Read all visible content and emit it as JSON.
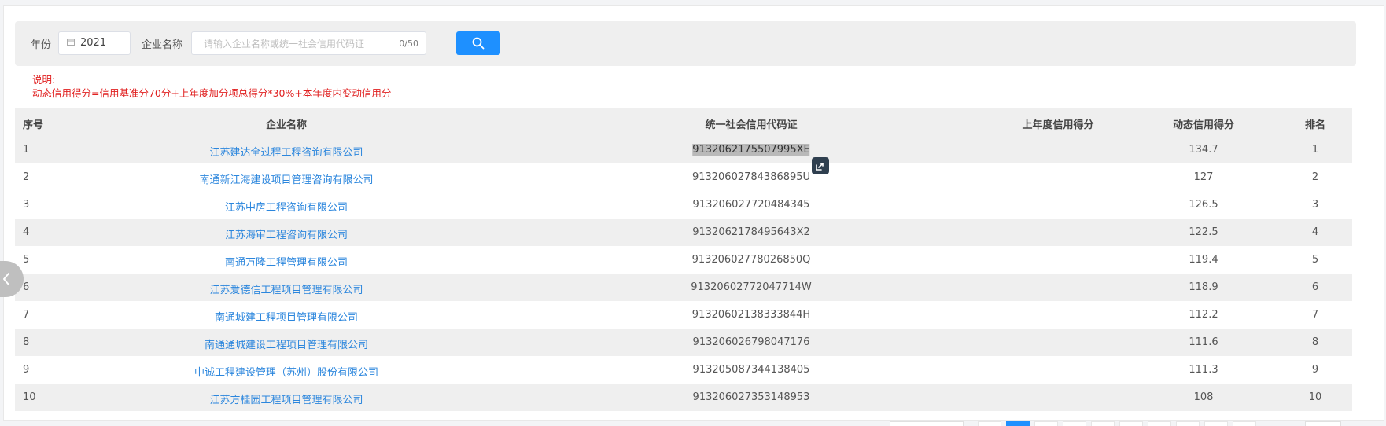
{
  "filter": {
    "year_label": "年份",
    "year_value": "2021",
    "name_label": "企业名称",
    "name_placeholder": "请输入企业名称或统一社会信用代码证",
    "name_count": "0/50"
  },
  "note": {
    "title": "说明:",
    "text": "动态信用得分=信用基准分70分+上年度加分项总得分*30%+本年度内变动信用分"
  },
  "table": {
    "headers": {
      "index": "序号",
      "name": "企业名称",
      "code": "统一社会信用代码证",
      "prev": "上年度信用得分",
      "dynamic": "动态信用得分",
      "rank": "排名"
    },
    "rows": [
      {
        "index": "1",
        "name": "江苏建达全过程工程咨询有限公司",
        "code": "9132062175507995XE",
        "prev": "",
        "dynamic": "134.7",
        "rank": "1"
      },
      {
        "index": "2",
        "name": "南通新江海建设项目管理咨询有限公司",
        "code": "91320602784386895U",
        "prev": "",
        "dynamic": "127",
        "rank": "2"
      },
      {
        "index": "3",
        "name": "江苏中房工程咨询有限公司",
        "code": "913206027720484345",
        "prev": "",
        "dynamic": "126.5",
        "rank": "3"
      },
      {
        "index": "4",
        "name": "江苏海审工程咨询有限公司",
        "code": "9132062178495643X2",
        "prev": "",
        "dynamic": "122.5",
        "rank": "4"
      },
      {
        "index": "5",
        "name": "南通万隆工程管理有限公司",
        "code": "91320602778026850Q",
        "prev": "",
        "dynamic": "119.4",
        "rank": "5"
      },
      {
        "index": "6",
        "name": "江苏爱德信工程项目管理有限公司",
        "code": "91320602772047714W",
        "prev": "",
        "dynamic": "118.9",
        "rank": "6"
      },
      {
        "index": "7",
        "name": "南通城建工程项目管理有限公司",
        "code": "91320602138333844H",
        "prev": "",
        "dynamic": "112.2",
        "rank": "7"
      },
      {
        "index": "8",
        "name": "南通通城建设工程项目管理有限公司",
        "code": "913206026798047176",
        "prev": "",
        "dynamic": "111.6",
        "rank": "8"
      },
      {
        "index": "9",
        "name": "中诚工程建设管理（苏州）股份有限公司",
        "code": "913205087344138405",
        "prev": "",
        "dynamic": "111.3",
        "rank": "9"
      },
      {
        "index": "10",
        "name": "江苏方桂园工程项目管理有限公司",
        "code": "913206027353148953",
        "prev": "",
        "dynamic": "108",
        "rank": "10"
      }
    ]
  },
  "colors": {
    "accent": "#1e90ff",
    "link": "#2b86dd",
    "note_red": "#e02020",
    "stripe": "#efefef"
  },
  "icons": {
    "calendar": "calendar-icon",
    "search": "search-icon",
    "external": "external-link-icon",
    "prev": "chevron-left-icon"
  }
}
